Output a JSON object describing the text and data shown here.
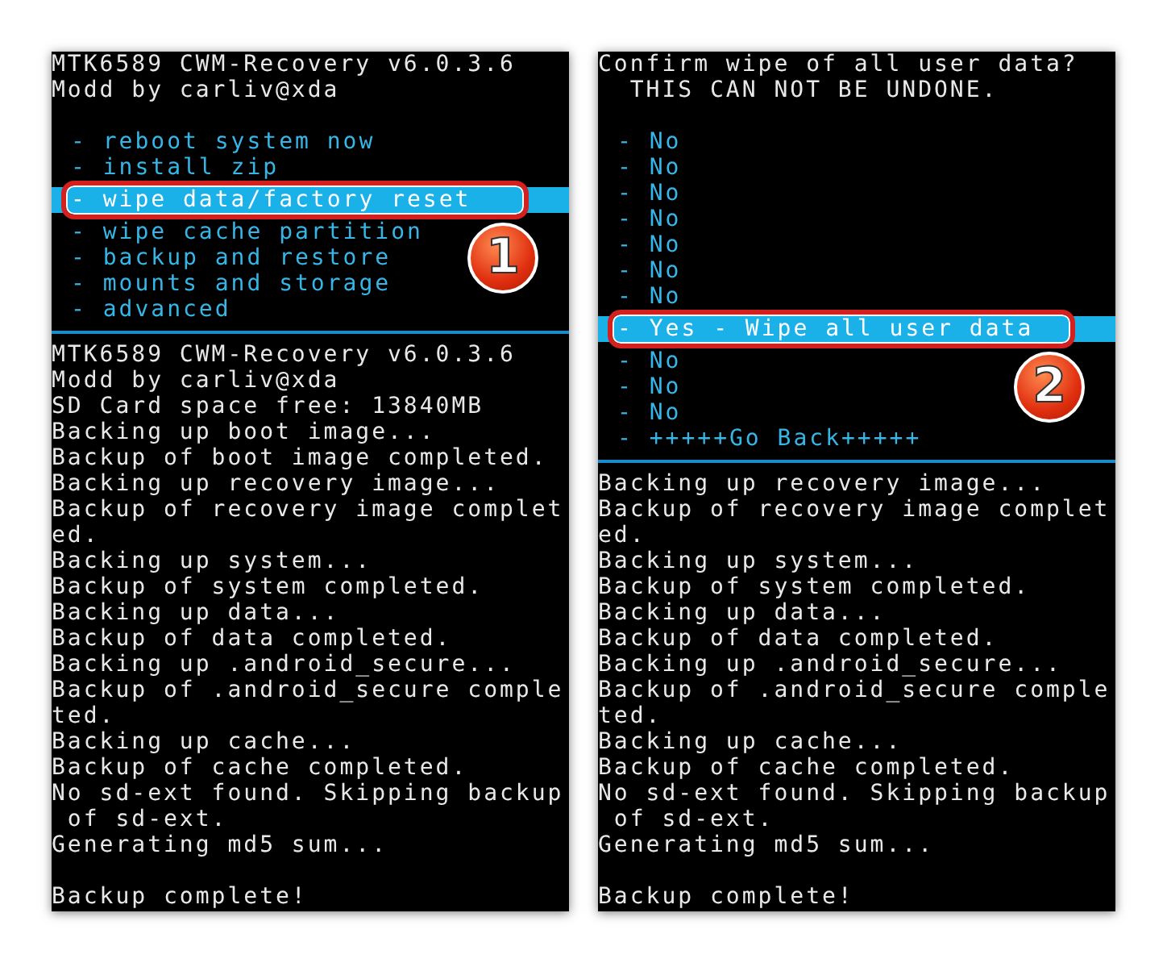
{
  "screens": [
    {
      "header": [
        "MTK6589 CWM-Recovery v6.0.3.6",
        "Modd by carliv@xda"
      ],
      "menu": [
        {
          "label": "- reboot system now",
          "selected": false
        },
        {
          "label": "- install zip",
          "selected": false
        },
        {
          "label": "- wipe data/factory reset",
          "selected": true
        },
        {
          "label": "- wipe cache partition",
          "selected": false
        },
        {
          "label": "- backup and restore",
          "selected": false
        },
        {
          "label": "- mounts and storage",
          "selected": false
        },
        {
          "label": "- advanced",
          "selected": false
        }
      ],
      "log": [
        "MTK6589 CWM-Recovery v6.0.3.6",
        "Modd by carliv@xda",
        "SD Card space free: 13840MB",
        "Backing up boot image...",
        "Backup of boot image completed.",
        "Backing up recovery image...",
        "Backup of recovery image complet",
        "ed.",
        "Backing up system...",
        "Backup of system completed.",
        "Backing up data...",
        "Backup of data completed.",
        "Backing up .android_secure...",
        "Backup of .android_secure comple",
        "ted.",
        "Backing up cache...",
        "Backup of cache completed.",
        "No sd-ext found. Skipping backup",
        " of sd-ext.",
        "Generating md5 sum..."
      ],
      "footer": "Backup complete!",
      "callout": {
        "number": "1"
      }
    },
    {
      "header": [
        "Confirm wipe of all user data?",
        "  THIS CAN NOT BE UNDONE."
      ],
      "menu": [
        {
          "label": "- No",
          "selected": false
        },
        {
          "label": "- No",
          "selected": false
        },
        {
          "label": "- No",
          "selected": false
        },
        {
          "label": "- No",
          "selected": false
        },
        {
          "label": "- No",
          "selected": false
        },
        {
          "label": "- No",
          "selected": false
        },
        {
          "label": "- No",
          "selected": false
        },
        {
          "label": "- Yes - Wipe all user data",
          "selected": true
        },
        {
          "label": "- No",
          "selected": false
        },
        {
          "label": "- No",
          "selected": false
        },
        {
          "label": "- No",
          "selected": false
        },
        {
          "label": "- +++++Go Back+++++",
          "selected": false
        }
      ],
      "log": [
        "Backing up recovery image...",
        "Backup of recovery image complet",
        "ed.",
        "Backing up system...",
        "Backup of system completed.",
        "Backing up data...",
        "Backup of data completed.",
        "Backing up .android_secure...",
        "Backup of .android_secure comple",
        "ted.",
        "Backing up cache...",
        "Backup of cache completed.",
        "No sd-ext found. Skipping backup",
        " of sd-ext.",
        "Generating md5 sum..."
      ],
      "footer": "Backup complete!",
      "callout": {
        "number": "2"
      }
    }
  ]
}
